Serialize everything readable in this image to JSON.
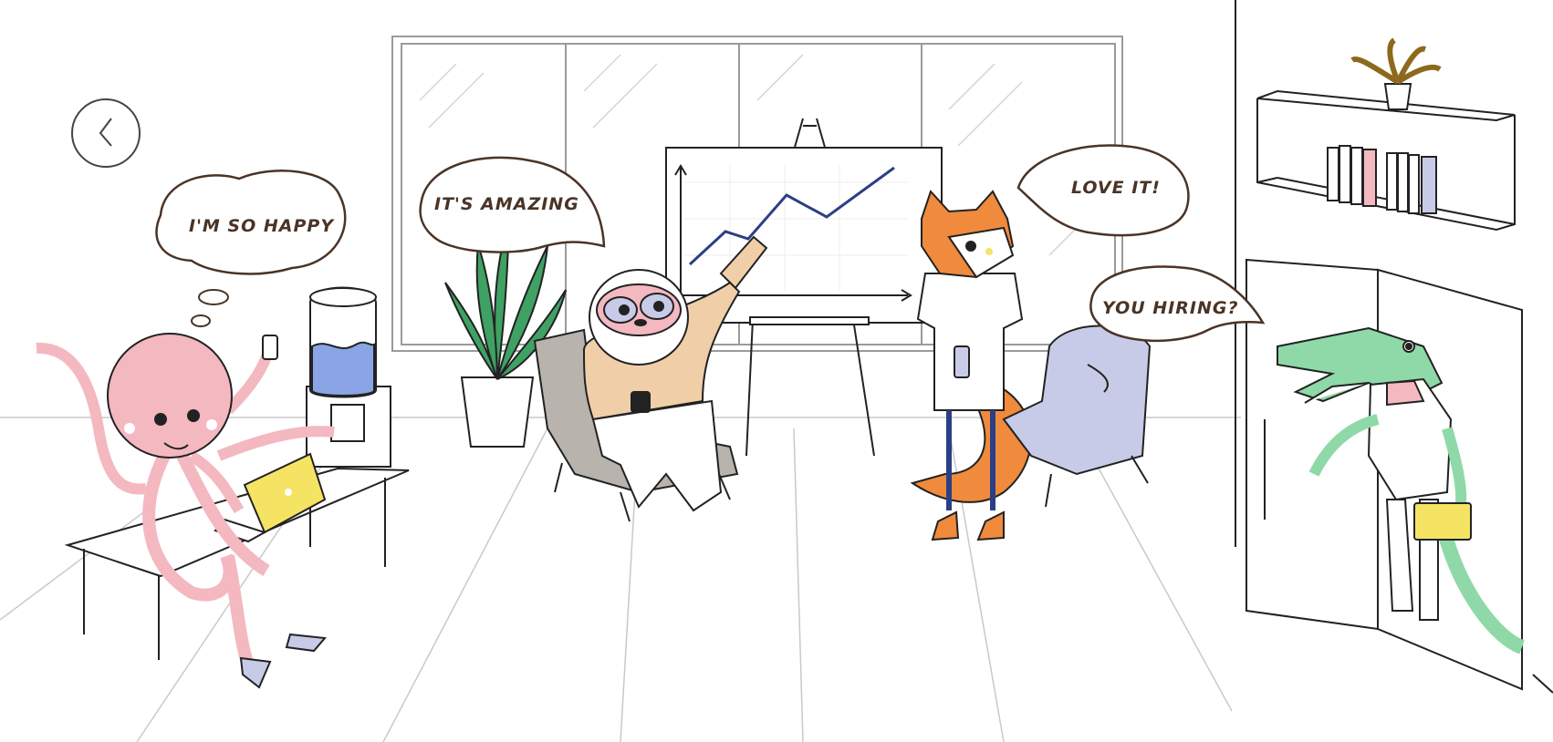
{
  "navigation": {
    "back_icon": "chevron-left-icon"
  },
  "speech_bubbles": {
    "octopus": "I'M SO HAPPY",
    "sloth": "IT'S AMAZING",
    "fox": "LOVE IT!",
    "crocodile": "YOU HIRING?"
  },
  "colors": {
    "line": "#222222",
    "bubble_outline": "#4a3426",
    "chart_line": "#2b3f86",
    "octopus": "#f4b8c0",
    "crocodile": "#8fd9a8",
    "fox": "#f08a3c",
    "sloth_jacket": "#f0cfa8",
    "armchair": "#c8cbe8",
    "laptop": "#f5e463",
    "water": "#8aa4e6",
    "plant": "#3fa163"
  }
}
